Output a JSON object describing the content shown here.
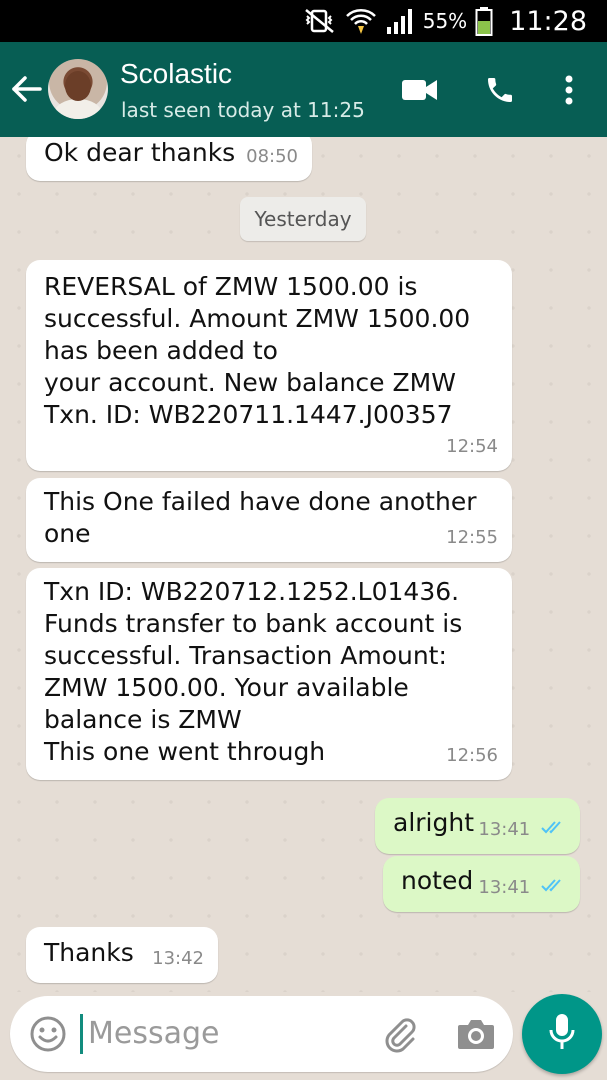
{
  "status_bar": {
    "battery_percent": "55%",
    "clock": "11:28"
  },
  "header": {
    "contact_name": "Scolastic",
    "last_seen": "last seen today at 11:25"
  },
  "chat": {
    "date_divider": "Yesterday",
    "messages": [
      {
        "direction": "in",
        "text": "Ok dear thanks",
        "time": "08:50"
      },
      {
        "direction": "in",
        "text": "REVERSAL of ZMW 1500.00 is\nsuccessful. Amount ZMW 1500.00\nhas been added to\nyour account. New balance ZMW\nTxn. ID: WB220711.1447.J00357",
        "time": "12:54"
      },
      {
        "direction": "in",
        "text": "This One failed have done another\none",
        "time": "12:55"
      },
      {
        "direction": "in",
        "text": "Txn ID: WB220712.1252.L01436.\nFunds transfer to bank account is\nsuccessful. Transaction Amount:\nZMW 1500.00. Your available\nbalance is ZMW\nThis one went through",
        "time": "12:56"
      },
      {
        "direction": "out",
        "text": "alright",
        "time": "13:41"
      },
      {
        "direction": "out",
        "text": "noted",
        "time": "13:41"
      },
      {
        "direction": "in",
        "text": "Thanks",
        "time": "13:42"
      }
    ]
  },
  "composer": {
    "placeholder": "Message"
  },
  "colors": {
    "header": "#075e54",
    "chat_background": "#e5ddd5",
    "outgoing_bubble": "#dcf8c6",
    "incoming_bubble": "#ffffff",
    "read_ticks": "#4fc3f7",
    "mic_button": "#009688"
  },
  "icons": {
    "status_bar": [
      "vibrate-icon",
      "wifi-icon",
      "signal-icon",
      "battery-icon"
    ],
    "header": [
      "back-arrow-icon",
      "video-call-icon",
      "phone-icon",
      "more-options-icon"
    ],
    "composer": [
      "emoji-icon",
      "attach-icon",
      "camera-icon",
      "mic-icon"
    ]
  }
}
